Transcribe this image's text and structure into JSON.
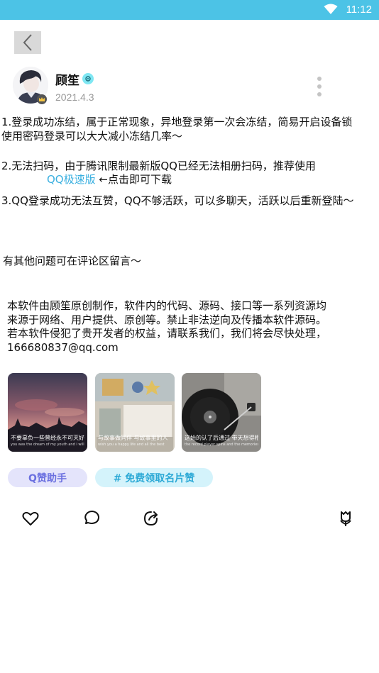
{
  "status_bar": {
    "time": "11:12",
    "wifi_icon": "wifi-icon",
    "background": "#4cc3e6"
  },
  "header": {
    "back_icon": "chevron-left-icon"
  },
  "author": {
    "name": "顾笙",
    "date": "2021.4.3",
    "avatar_icon": "avatar",
    "badge_icon": "crown-icon",
    "tag_icon": "verified-icon"
  },
  "post": {
    "p1_line1": "1.登录成功冻结，属于正常现象，异地登录第一次会冻结，简易开启设备锁",
    "p1_line2": "使用密码登录可以大大减小冻结几率～",
    "p2_line1": "2.无法扫码，由于腾讯限制最新版QQ已经无法相册扫码，推荐使用",
    "p2_link": "QQ极速版",
    "p2_suffix": " ←点击即可下载",
    "p3": "3.QQ登录成功无法互赞，QQ不够活跃，可以多聊天，活跃以后重新登陆～",
    "p4": "有其他问题可在评论区留言～",
    "p5_line1": "本软件由顾笙原创制作，软件内的代码、源码、接口等一系列资源均",
    "p5_line2": "来源于网络、用户提供、原创等。禁止非法逆向及传播本软件源码。",
    "p5_line3": "若本软件侵犯了贵开发者的权益，请联系我们，我们将会尽快处理，",
    "p5_line4": "166680837@qq.com"
  },
  "images": [
    {
      "caption": "不要辜负一些曾经永不可灭好往惟人",
      "sub": "you was the dream of my youth and i will never forget"
    },
    {
      "caption": "与故事做同伴 与故事里的人",
      "sub": "wish you a happy life and all the best"
    },
    {
      "caption": "这始的认了后通过 带天想得相同而命运同的路",
      "sub": "the record player spins and the memories return again"
    }
  ],
  "tags": {
    "tag1": "Q赞助手",
    "tag2": "# 免费领取名片赞"
  },
  "actions": {
    "like_icon": "heart-icon",
    "comment_icon": "comment-icon",
    "share_icon": "share-icon",
    "gift_icon": "flower-icon"
  }
}
